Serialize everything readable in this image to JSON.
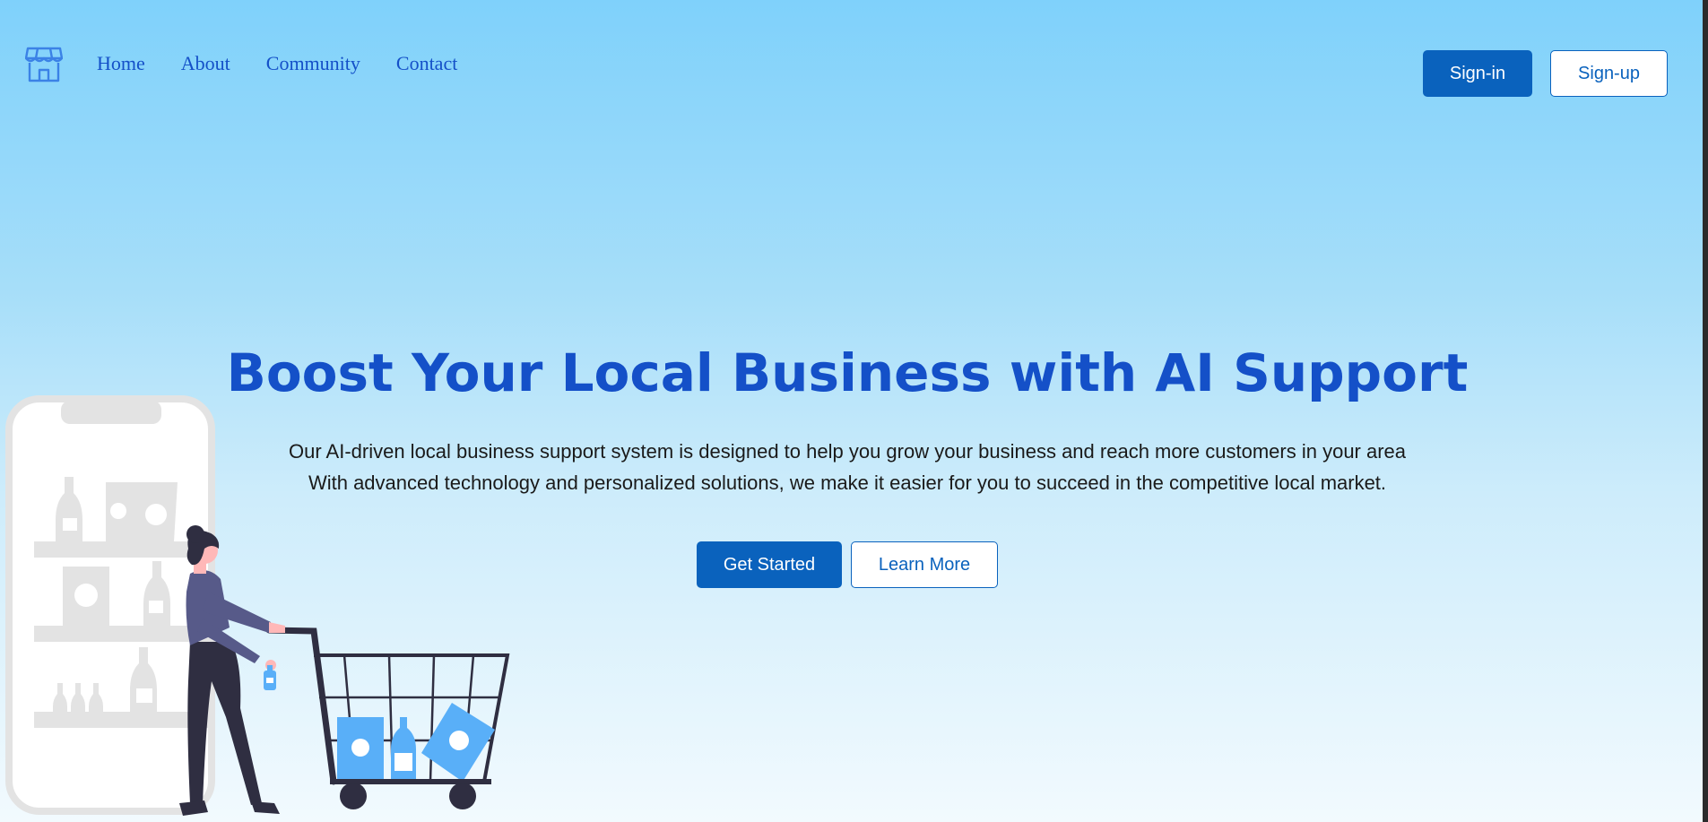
{
  "nav": {
    "brand_icon": "storefront-icon",
    "links": [
      "Home",
      "About",
      "Community",
      "Contact"
    ]
  },
  "auth": {
    "signin": "Sign-in",
    "signup": "Sign-up"
  },
  "hero": {
    "title": "Boost Your Local Business with AI Support",
    "line1": "Our AI-driven local business support system is designed to help you grow your business and reach more customers in your area",
    "line2": "With advanced technology and personalized solutions, we make it easier for you to succeed in the competitive local market.",
    "get_started": "Get Started",
    "learn_more": "Learn More",
    "illustration": "woman-shopping-cart-illustration"
  },
  "colors": {
    "accent": "#0a62bd",
    "heading": "#1450c8",
    "background_top": "#7fd1fb",
    "background_bottom": "#f2fafe"
  }
}
